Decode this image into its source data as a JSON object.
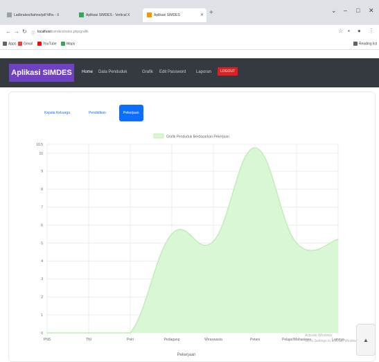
{
  "browser": {
    "tabs": [
      {
        "label": "Ladbrakes/kahne/pdf Mhs - X",
        "favicon_color": "#9aa0a6",
        "active": false
      },
      {
        "label": "Aplikasi SIMDES - Vertical X",
        "favicon_color": "#34a853",
        "active": false
      },
      {
        "label": "Aplikasi SIMDES",
        "favicon_color": "#f29900",
        "active": true
      }
    ],
    "new_tab": "+",
    "window_controls": [
      "⌄",
      "–",
      "□",
      "✕"
    ],
    "url_host": "localhost",
    "url_path": "/simdes/index.php/grafik",
    "bookmarks": [
      {
        "label": "Apps",
        "icon_color": "#5f6368"
      },
      {
        "label": "Gmail",
        "icon_color": "#ea4335"
      },
      {
        "label": "YouTube",
        "icon_color": "#ff0000"
      },
      {
        "label": "Maps",
        "icon_color": "#34a853"
      }
    ],
    "reading_list": "Reading list"
  },
  "app": {
    "brand": "Aplikasi SIMDES",
    "nav": [
      "Home",
      "Data Penduduk",
      "Grafik",
      "Edit Password",
      "Laporan"
    ],
    "logout": "LOGOUT",
    "pills": [
      "Kepala Keluarga",
      "Pendidikan",
      "Pekerjaan"
    ],
    "active_pill": 2,
    "accent": "#0d6efd",
    "brand_color": "#6f42c1"
  },
  "chart_data": {
    "type": "area",
    "legend": "Grafik Penduduk Berdasarkan Pekerjaan",
    "xlabel": "Pekerjaan",
    "categories": [
      "PNS",
      "TNI",
      "Polri",
      "Pedagang",
      "Wiraswasta",
      "Petani",
      "Pelajar/Mahasiswa",
      "Lainnya"
    ],
    "values": [
      0,
      0,
      0,
      5.5,
      5.1,
      10.3,
      5.0,
      5.2
    ],
    "ylim": [
      0,
      10.5
    ],
    "ticks": [
      "0",
      "1",
      "2",
      "3",
      "4",
      "5",
      "6",
      "7",
      "8",
      "9",
      "10",
      "10.5"
    ],
    "fill_color": "#d9f7d4",
    "line_color": "#bfeeb6",
    "grid": true
  },
  "watermark": [
    "Activate Windows",
    "Go to Settings to activate Windows."
  ],
  "scroll_top": "▲"
}
